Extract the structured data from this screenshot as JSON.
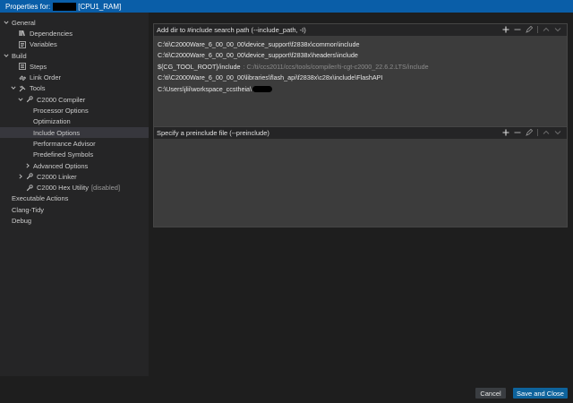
{
  "window": {
    "title_prefix": "Properties for:",
    "title_suffix": "[CPU1_RAM]"
  },
  "sidebar": {
    "items": [
      {
        "label": "General",
        "level": 0,
        "expander": "down",
        "icon": "",
        "selected": false
      },
      {
        "label": "Dependencies",
        "level": 1,
        "expander": "",
        "icon": "dependencies-icon",
        "selected": false
      },
      {
        "label": "Variables",
        "level": 1,
        "expander": "",
        "icon": "variables-icon",
        "selected": false
      },
      {
        "label": "Build",
        "level": 0,
        "expander": "down",
        "icon": "",
        "selected": false
      },
      {
        "label": "Steps",
        "level": 1,
        "expander": "",
        "icon": "steps-icon",
        "selected": false
      },
      {
        "label": "Link Order",
        "level": 1,
        "expander": "",
        "icon": "link-icon",
        "selected": false
      },
      {
        "label": "Tools",
        "level": 1,
        "expander": "down",
        "icon": "tools-icon",
        "selected": false
      },
      {
        "label": "C2000 Compiler",
        "level": 2,
        "expander": "down",
        "icon": "wrench-icon",
        "selected": false
      },
      {
        "label": "Processor Options",
        "level": 3,
        "expander": "",
        "icon": "",
        "selected": false
      },
      {
        "label": "Optimization",
        "level": 3,
        "expander": "",
        "icon": "",
        "selected": false
      },
      {
        "label": "Include Options",
        "level": 3,
        "expander": "",
        "icon": "",
        "selected": true
      },
      {
        "label": "Performance Advisor",
        "level": 3,
        "expander": "",
        "icon": "",
        "selected": false
      },
      {
        "label": "Predefined Symbols",
        "level": 3,
        "expander": "",
        "icon": "",
        "selected": false
      },
      {
        "label": "Advanced Options",
        "level": 3,
        "expander": "right",
        "icon": "",
        "selected": false
      },
      {
        "label": "C2000 Linker",
        "level": 2,
        "expander": "right",
        "icon": "wrench-icon",
        "selected": false
      },
      {
        "label": "C2000 Hex Utility",
        "level": 2,
        "expander": "",
        "icon": "wrench-icon",
        "selected": false,
        "tag": "[disabled]"
      },
      {
        "label": "Executable Actions",
        "level": 0,
        "expander": "",
        "icon": "",
        "selected": false
      },
      {
        "label": "Clang-Tidy",
        "level": 0,
        "expander": "",
        "icon": "",
        "selected": false
      },
      {
        "label": "Debug",
        "level": 0,
        "expander": "",
        "icon": "",
        "selected": false
      }
    ]
  },
  "include_panel": {
    "title": "Add dir to #include search path (--include_path, -I)",
    "paths": [
      {
        "text": "C:\\ti\\C2000Ware_6_00_00_00\\device_support\\f2838x\\common\\include",
        "resolved": ""
      },
      {
        "text": "C:\\ti\\C2000Ware_6_00_00_00\\device_support\\f2838x\\headers\\include",
        "resolved": ""
      },
      {
        "text": "${CG_TOOL_ROOT}/include",
        "resolved": ": C:/ti/ccs2011/ccs/tools/compiler/ti-cgt-c2000_22.6.2.LTS/include"
      },
      {
        "text": "C:\\ti\\C2000Ware_6_00_00_00\\libraries\\flash_api\\f2838x\\c28x\\include\\FlashAPI",
        "resolved": ""
      },
      {
        "text": "C:\\Users\\jlii\\workspace_ccstheia\\",
        "resolved": "",
        "redacted": true
      }
    ]
  },
  "preinclude_panel": {
    "title": "Specify a preinclude file (--preinclude)"
  },
  "footer": {
    "cancel_label": "Cancel",
    "save_label": "Save and Close"
  }
}
